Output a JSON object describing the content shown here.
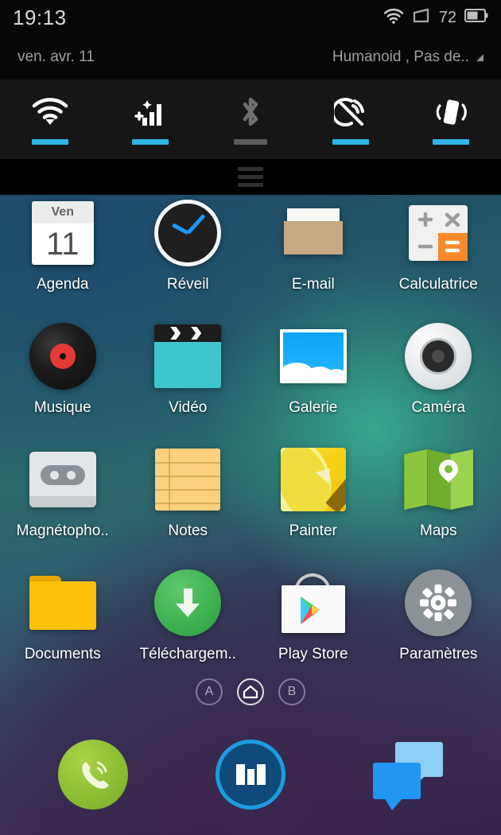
{
  "status_bar": {
    "time": "19:13",
    "battery_percent": "72",
    "icons": [
      "wifi-icon",
      "signal-icon",
      "battery-icon"
    ]
  },
  "date_row": {
    "date": "ven.  avr. 11",
    "carrier": "Humanoid , Pas de..",
    "expand_icon": "triangle-expand-icon"
  },
  "quick_settings": {
    "toggles": [
      {
        "name": "wifi",
        "icon": "wifi-icon",
        "state": "on"
      },
      {
        "name": "data",
        "icon": "signal-bars-icon",
        "state": "on"
      },
      {
        "name": "bluetooth",
        "icon": "bluetooth-icon",
        "state": "off"
      },
      {
        "name": "gps",
        "icon": "gps-off-icon",
        "state": "on"
      },
      {
        "name": "vibrate",
        "icon": "vibrate-icon",
        "state": "on"
      }
    ],
    "active_color": "#33b5e5",
    "inactive_color": "#5a5a5a"
  },
  "drawer_handle": {
    "icon": "drag-handle-icon"
  },
  "apps": [
    {
      "label": "Agenda",
      "icon": "calendar-icon",
      "cal_weekday": "Ven",
      "cal_day": "11"
    },
    {
      "label": "Réveil",
      "icon": "alarm-clock-icon"
    },
    {
      "label": "E-mail",
      "icon": "envelope-icon"
    },
    {
      "label": "Calculatrice",
      "icon": "calculator-icon",
      "keys": [
        "+",
        "×",
        "−",
        "="
      ]
    },
    {
      "label": "Musique",
      "icon": "vinyl-record-icon"
    },
    {
      "label": "Vidéo",
      "icon": "clapperboard-icon"
    },
    {
      "label": "Galerie",
      "icon": "photo-icon"
    },
    {
      "label": "Caméra",
      "icon": "camera-lens-icon"
    },
    {
      "label": "Magnétopho..",
      "icon": "cassette-tape-icon"
    },
    {
      "label": "Notes",
      "icon": "notepad-icon"
    },
    {
      "label": "Painter",
      "icon": "pencil-paint-icon"
    },
    {
      "label": "Maps",
      "icon": "folded-map-pin-icon"
    },
    {
      "label": "Documents",
      "icon": "folder-icon"
    },
    {
      "label": "Téléchargem..",
      "icon": "download-arrow-icon"
    },
    {
      "label": "Play Store",
      "icon": "play-store-bag-icon"
    },
    {
      "label": "Paramètres",
      "icon": "gear-icon"
    }
  ],
  "page_indicators": [
    {
      "label": "A",
      "icon": "page-a-icon",
      "active": false
    },
    {
      "label": "",
      "icon": "home-icon",
      "active": true
    },
    {
      "label": "B",
      "icon": "page-b-icon",
      "active": false
    }
  ],
  "dock": [
    {
      "name": "phone",
      "icon": "phone-icon"
    },
    {
      "name": "meizu-app",
      "icon": "meizu-logo-icon"
    },
    {
      "name": "messaging",
      "icon": "chat-bubbles-icon"
    }
  ],
  "colors": {
    "accent_blue": "#33b5e5",
    "calc_orange": "#f7892b",
    "folder_yellow": "#fdc008",
    "download_green": "#3fb252",
    "phone_green": "#8dbe33"
  }
}
